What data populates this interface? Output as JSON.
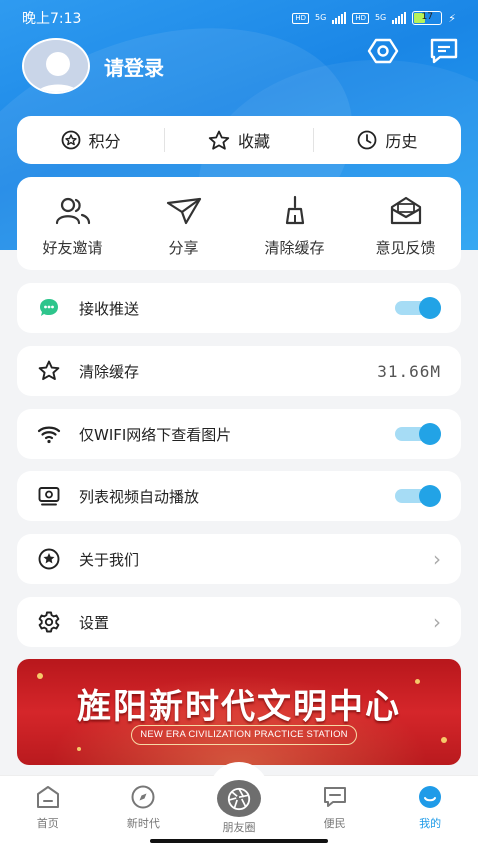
{
  "status_bar": {
    "time": "晚上7:13",
    "hd1": "HD",
    "net1": "5G",
    "hd2": "HD",
    "net2": "5G",
    "battery": "17"
  },
  "header": {
    "login_text": "请登录",
    "settings_icon": "hexagon-settings-icon",
    "message_icon": "chat-bubble-icon"
  },
  "stats": [
    {
      "label": "积分",
      "icon": "points-star-circle-icon"
    },
    {
      "label": "收藏",
      "icon": "star-icon"
    },
    {
      "label": "历史",
      "icon": "clock-icon"
    }
  ],
  "tools": [
    {
      "label": "好友邀请",
      "icon": "friends-icon"
    },
    {
      "label": "分享",
      "icon": "paper-plane-icon"
    },
    {
      "label": "清除缓存",
      "icon": "broom-icon"
    },
    {
      "label": "意见反馈",
      "icon": "mail-feedback-icon"
    }
  ],
  "settings": [
    {
      "label": "接收推送",
      "icon": "chat-green-icon",
      "type": "toggle",
      "on": true
    },
    {
      "label": "清除缓存",
      "icon": "star-outline-icon",
      "type": "value",
      "value": "31.66M"
    },
    {
      "label": "仅WIFI网络下查看图片",
      "icon": "wifi-icon",
      "type": "toggle",
      "on": true
    },
    {
      "label": "列表视频自动播放",
      "icon": "video-icon",
      "type": "toggle",
      "on": true
    },
    {
      "label": "关于我们",
      "icon": "info-star-icon",
      "type": "chevron"
    },
    {
      "label": "设置",
      "icon": "gear-icon",
      "type": "chevron"
    }
  ],
  "banner": {
    "title": "旌阳新时代文明中心",
    "subtitle": "NEW ERA CIVILIZATION PRACTICE STATION"
  },
  "tabbar": [
    {
      "label": "首页",
      "icon": "home-icon",
      "active": false
    },
    {
      "label": "新时代",
      "icon": "compass-icon",
      "active": false
    },
    {
      "label": "朋友圈",
      "icon": "camera-shutter-icon",
      "active": false
    },
    {
      "label": "便民",
      "icon": "message-icon",
      "active": false
    },
    {
      "label": "我的",
      "icon": "smile-icon",
      "active": true
    }
  ],
  "colors": {
    "hero_blue": "#1a86e6",
    "accent": "#22a3e6",
    "toggle_track": "#a6dcf5",
    "banner_red": "#d5262a"
  }
}
